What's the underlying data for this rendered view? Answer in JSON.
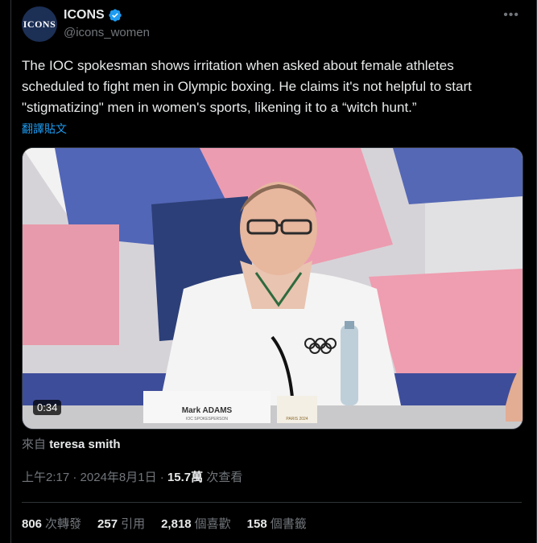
{
  "author": {
    "display_name": "ICONS",
    "handle": "@icons_women",
    "avatar_text": "ICONS"
  },
  "tweet": {
    "text": "The IOC spokesman shows irritation when asked about female athletes scheduled to fight men in Olympic boxing. He claims it's not helpful to start \"stigmatizing\" men in women's sports, likening it to a “witch hunt.”",
    "translate_label": "翻譯貼文"
  },
  "video": {
    "duration": "0:34",
    "nameplate_name": "Mark ADAMS",
    "nameplate_title": "IOC SPOKESPERSON",
    "paris_label": "PARIS 2024"
  },
  "source": {
    "prefix": "來自",
    "name": "teresa smith"
  },
  "meta": {
    "time": "上午2:17",
    "sep1": "·",
    "date": "2024年8月1日",
    "sep2": "·",
    "views": "15.7萬",
    "views_label": "次查看"
  },
  "stats": [
    {
      "value": "806",
      "label": "次轉發"
    },
    {
      "value": "257",
      "label": "引用"
    },
    {
      "value": "2,818",
      "label": "個喜歡"
    },
    {
      "value": "158",
      "label": "個書籤"
    }
  ],
  "colors": {
    "accent": "#1d9bf0",
    "background": "#000000",
    "text": "#e7e9ea",
    "muted": "#71767b"
  }
}
